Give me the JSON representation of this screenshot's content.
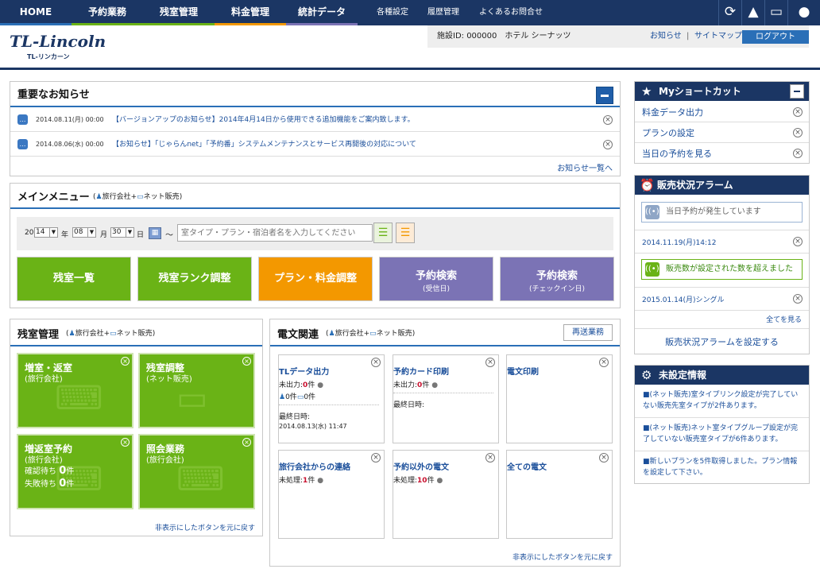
{
  "topnav": {
    "tabs": [
      "HOME",
      "予約業務",
      "残室管理",
      "料金管理",
      "統計データ"
    ],
    "tab_colors": [
      "#2a6fb7",
      "#6ab316",
      "#6ab316",
      "#f39800",
      "#7b73b5"
    ],
    "links": [
      "各種設定",
      "履歴管理",
      "よくあるお問合せ"
    ],
    "icons": [
      "refresh-icon",
      "alert-icon",
      "monitor-icon",
      "user-icon"
    ]
  },
  "header": {
    "logo": "TL-Lincoln",
    "logo_sub": "TL-リンカーン",
    "facility": "施設ID: 000000　ホテル シーナッツ",
    "link_news": "お知らせ",
    "separator": "|",
    "link_sitemap": "サイトマップ",
    "logout": "ログアウト"
  },
  "news": {
    "title": "重要なお知らせ",
    "items": [
      {
        "date": "2014.08.11(月) 00:00",
        "text": "【バージョンアップのお知らせ】2014年4月14日から使用できる追加機能をご案内致します。"
      },
      {
        "date": "2014.08.06(水) 00:00",
        "text": "【お知らせ】「じゃらんnet」「予約番」システムメンテナンスとサービス再開後の対応について"
      }
    ],
    "more": "お知らせ一覧へ"
  },
  "main_menu": {
    "title": "メインメニュー",
    "legend_agency": "旅行会社",
    "legend_plus": "+",
    "legend_net": "ネット販売",
    "date": {
      "year_prefix": "20",
      "year": "14",
      "year_label": "年",
      "month": "08",
      "month_label": "月",
      "day": "30",
      "day_label": "日",
      "tilde": "〜"
    },
    "search_placeholder": "室タイプ・プラン・宿泊者名を入力してください",
    "buttons": [
      {
        "label": "残室一覧",
        "sub": ""
      },
      {
        "label": "残室ランク調整",
        "sub": ""
      },
      {
        "label": "プラン・料金調整",
        "sub": ""
      },
      {
        "label": "予約検索",
        "sub": "(受信日)"
      },
      {
        "label": "予約検索",
        "sub": "(チェックイン日)"
      }
    ]
  },
  "room": {
    "title": "残室管理",
    "legend_agency": "旅行会社",
    "legend_plus": "+",
    "legend_net": "ネット販売",
    "tiles": [
      {
        "title": "増室・返室",
        "sub": "(旅行会社)"
      },
      {
        "title": "残室調整",
        "sub": "(ネット販売)"
      },
      {
        "title": "増返室予約",
        "sub": "(旅行会社)",
        "line1_label": "確認待ち",
        "line1_value": "0",
        "line2_label": "失敗待ち",
        "line2_value": "0",
        "unit": "件"
      },
      {
        "title": "照会業務",
        "sub": "(旅行会社)"
      }
    ],
    "restore": "非表示にしたボタンを元に戻す"
  },
  "telegram": {
    "title": "電文関連",
    "legend_agency": "旅行会社",
    "legend_plus": "+",
    "legend_net": "ネット販売",
    "resend": "再送業務",
    "tiles": [
      {
        "title": "TLデータ出力",
        "unsent_label": "未出力:",
        "unsent": "0",
        "unit": "件",
        "agency_count": "0件",
        "net_count": "0件",
        "last_label": "最終日時:",
        "last": "2014.08.13(水) 11:47"
      },
      {
        "title": "予約カード印刷",
        "unsent_label": "未出力:",
        "unsent": "0",
        "unit": "件",
        "last_label": "最終日時:"
      },
      {
        "title": "電文印刷"
      },
      {
        "title": "旅行会社からの連絡",
        "unsent_label": "未処理:",
        "unsent": "1",
        "unit": "件"
      },
      {
        "title": "予約以外の電文",
        "unsent_label": "未処理:",
        "unsent": "10",
        "unit": "件"
      },
      {
        "title": "全ての電文"
      }
    ],
    "restore": "非表示にしたボタンを元に戻す"
  },
  "shortcut": {
    "title": "Myショートカット",
    "items": [
      "料金データ出力",
      "プランの設定",
      "当日の予約を見る"
    ]
  },
  "alarm": {
    "title": "販売状況アラーム",
    "alerts": [
      {
        "text": "当日予約が発生しています",
        "date": "2014.11.19(月)14:12",
        "color": "#8fa6c6"
      },
      {
        "text": "販売数が設定された数を超えました",
        "date": "2015.01.14(月)シングル",
        "color": "#6ab316"
      }
    ],
    "see_all": "全てを見る",
    "configure": "販売状況アラームを設定する"
  },
  "unset": {
    "title": "未設定情報",
    "items": [
      "■(ネット販売)室タイプリンク設定が完了していない販売先室タイプが2件あります。",
      "■(ネット販売)ネット室タイプグループ設定が完了していない販売室タイプが6件あります。",
      "■新しいプランを5件取得しました。プラン情報を設定して下さい。"
    ]
  }
}
